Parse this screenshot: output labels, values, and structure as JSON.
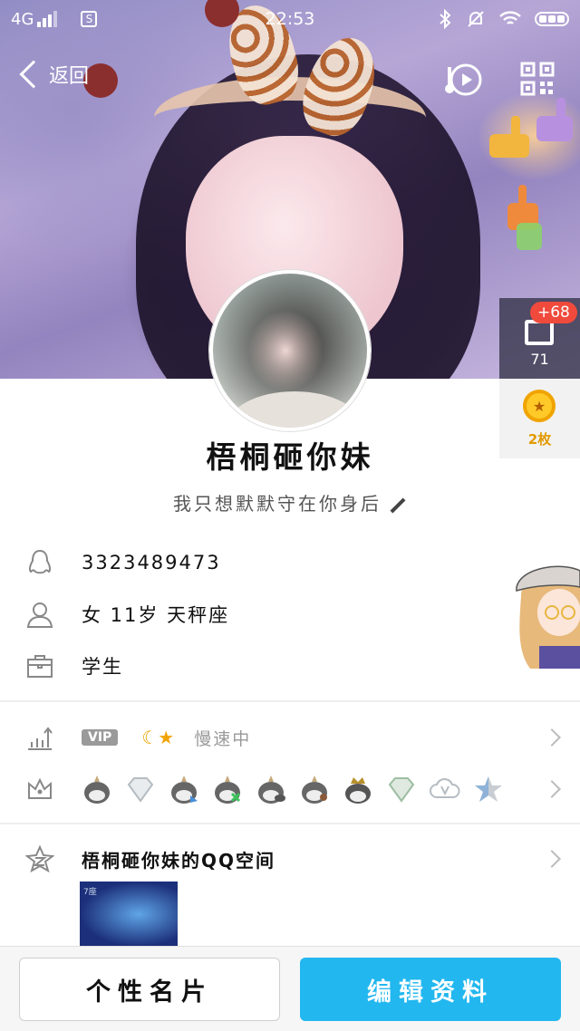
{
  "status_bar": {
    "network": "4G",
    "time": "22:53",
    "sim_icon": "S"
  },
  "nav": {
    "back_label": "返回",
    "music_icon": "music-note-play-icon",
    "qr_icon": "qr-code-icon"
  },
  "likes": {
    "new_count": "+68",
    "total": "71"
  },
  "badge": {
    "count_label": "2枚"
  },
  "profile": {
    "nickname": "梧桐砸你妹",
    "signature": "我只想默默守在你身后"
  },
  "info": {
    "qq_number": "3323489473",
    "personal": "女  11岁  天秤座",
    "occupation": "学生"
  },
  "level": {
    "vip_label": "VIP",
    "speed_text": "慢速中"
  },
  "qzone": {
    "title": "梧桐砸你妹的QQ空间",
    "thumb_text": "7座"
  },
  "actions": {
    "card_label": "个性名片",
    "edit_label": "编辑资料"
  },
  "colors": {
    "accent": "#22b7ef",
    "badge_red": "#f04a3c",
    "gold": "#f0a400"
  }
}
